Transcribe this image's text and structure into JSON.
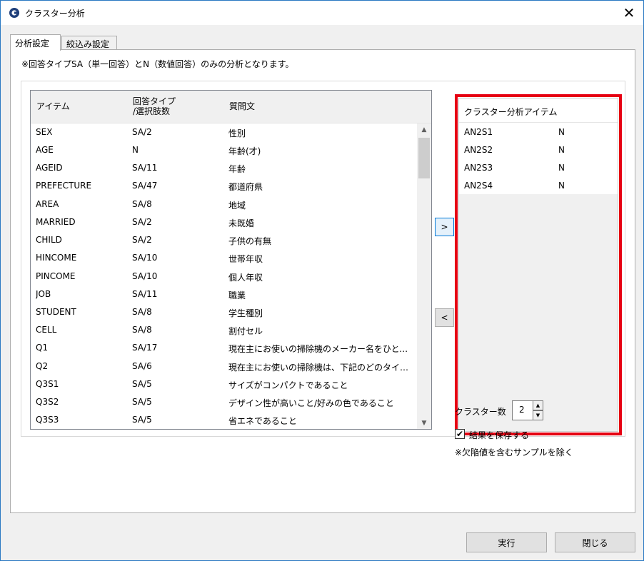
{
  "window": {
    "title": "クラスター分析",
    "close_icon": "✕"
  },
  "tabs": [
    {
      "label": "分析設定"
    },
    {
      "label": "絞込み設定"
    }
  ],
  "note": "※回答タイプSA（単一回答）とN（数値回答）のみの分析となります。",
  "item_list": {
    "headers": {
      "item": "アイテム",
      "type_line1": "回答タイプ",
      "type_line2": "/選択肢数",
      "question": "質問文"
    },
    "rows": [
      {
        "item": "SEX",
        "type": "SA/2",
        "question": "性別"
      },
      {
        "item": "AGE",
        "type": "N",
        "question": "年齢(才)"
      },
      {
        "item": "AGEID",
        "type": "SA/11",
        "question": "年齢"
      },
      {
        "item": "PREFECTURE",
        "type": "SA/47",
        "question": "都道府県"
      },
      {
        "item": "AREA",
        "type": "SA/8",
        "question": "地域"
      },
      {
        "item": "MARRIED",
        "type": "SA/2",
        "question": "未既婚"
      },
      {
        "item": "CHILD",
        "type": "SA/2",
        "question": "子供の有無"
      },
      {
        "item": "HINCOME",
        "type": "SA/10",
        "question": "世帯年収"
      },
      {
        "item": "PINCOME",
        "type": "SA/10",
        "question": "個人年収"
      },
      {
        "item": "JOB",
        "type": "SA/11",
        "question": "職業"
      },
      {
        "item": "STUDENT",
        "type": "SA/8",
        "question": "学生種別"
      },
      {
        "item": "CELL",
        "type": "SA/8",
        "question": "割付セル"
      },
      {
        "item": "Q1",
        "type": "SA/17",
        "question": "現在主にお使いの掃除機のメーカー名をひとつ..."
      },
      {
        "item": "Q2",
        "type": "SA/6",
        "question": "現在主にお使いの掃除機は、下記のどのタイプ..."
      },
      {
        "item": "Q3S1",
        "type": "SA/5",
        "question": "サイズがコンパクトであること"
      },
      {
        "item": "Q3S2",
        "type": "SA/5",
        "question": "デザイン性が高いこと/好みの色であること"
      },
      {
        "item": "Q3S3",
        "type": "SA/5",
        "question": "省エネであること"
      }
    ]
  },
  "buttons": {
    "add": ">",
    "remove": "<",
    "run": "実行",
    "close": "閉じる"
  },
  "cluster_list": {
    "header": "クラスター分析アイテム",
    "rows": [
      {
        "item": "AN2S1",
        "type": "N"
      },
      {
        "item": "AN2S2",
        "type": "N"
      },
      {
        "item": "AN2S3",
        "type": "N"
      },
      {
        "item": "AN2S4",
        "type": "N"
      }
    ]
  },
  "cluster_count": {
    "label": "クラスター数",
    "value": "2"
  },
  "save_result": {
    "label": "結果を保存する",
    "checked": true,
    "check_mark": "✔"
  },
  "exclude_note": "※欠陥値を含むサンプルを除く",
  "colors": {
    "highlight": "#e60012",
    "border": "#2b79c2"
  }
}
